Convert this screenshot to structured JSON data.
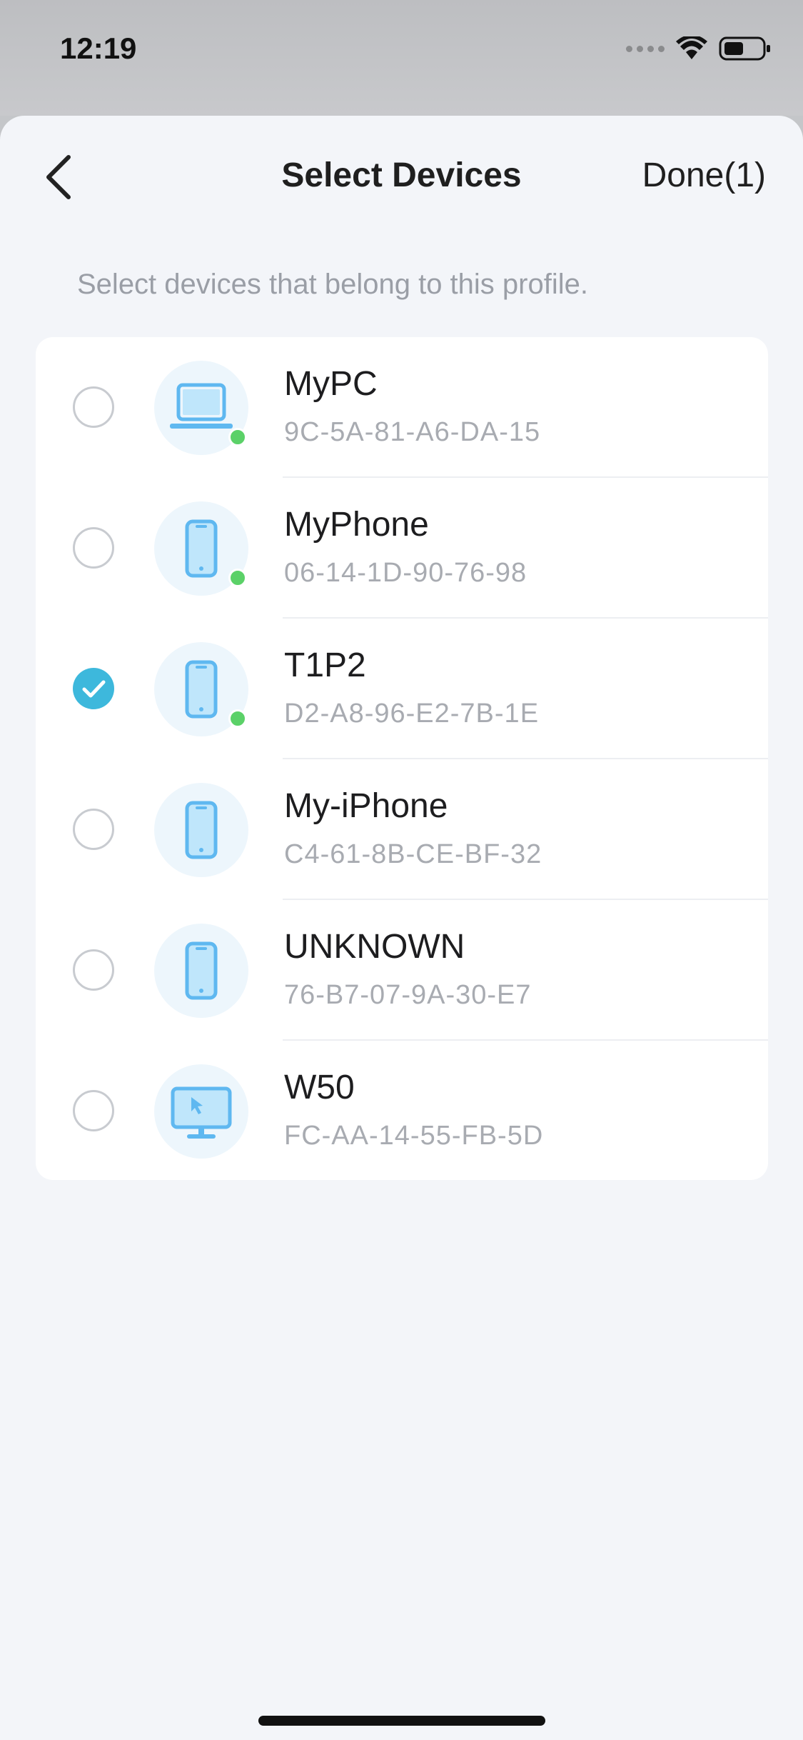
{
  "status_bar": {
    "time": "12:19"
  },
  "header": {
    "title": "Select Devices",
    "done_label": "Done(1)"
  },
  "hint": "Select devices that belong to this profile.",
  "devices": [
    {
      "name": "MyPC",
      "mac": "9C-5A-81-A6-DA-15",
      "icon": "laptop-icon",
      "online": true,
      "selected": false
    },
    {
      "name": "MyPhone",
      "mac": "06-14-1D-90-76-98",
      "icon": "phone-icon",
      "online": true,
      "selected": false
    },
    {
      "name": "T1P2",
      "mac": "D2-A8-96-E2-7B-1E",
      "icon": "phone-icon",
      "online": true,
      "selected": true
    },
    {
      "name": "My-iPhone",
      "mac": "C4-61-8B-CE-BF-32",
      "icon": "phone-icon",
      "online": false,
      "selected": false
    },
    {
      "name": "UNKNOWN",
      "mac": "76-B7-07-9A-30-E7",
      "icon": "phone-icon",
      "online": false,
      "selected": false
    },
    {
      "name": "W50",
      "mac": "FC-AA-14-55-FB-5D",
      "icon": "monitor-icon",
      "online": false,
      "selected": false
    }
  ],
  "colors": {
    "accent": "#3db8dc",
    "online": "#5bd168",
    "icon": "#5fb8f0"
  }
}
